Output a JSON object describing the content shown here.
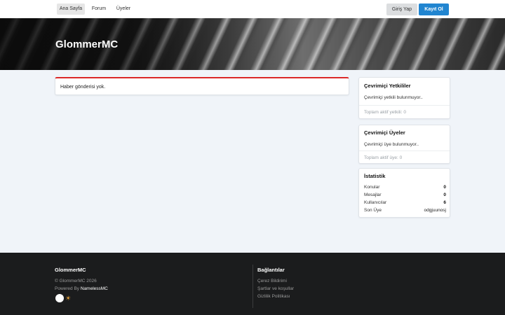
{
  "nav": {
    "items": [
      {
        "label": "Ana Sayfa",
        "active": true
      },
      {
        "label": "Forum",
        "active": false
      },
      {
        "label": "Üyeler",
        "active": false
      }
    ],
    "login_label": "Giriş Yap",
    "register_label": "Kayıt Ol"
  },
  "banner": {
    "title": "GlommerMC"
  },
  "news": {
    "empty_text": "Haber gönderisi yok."
  },
  "sidebar": {
    "staff": {
      "title": "Çevrimiçi Yetkililer",
      "empty_text": "Çevrimiçi yetkili bulunmuyor..",
      "total_text": "Toplam aktif yetkili: 0"
    },
    "members": {
      "title": "Çevrimiçi Üyeler",
      "empty_text": "Çevrimiçi üye bulunmuyor..",
      "total_text": "Toplam aktif üye: 0"
    },
    "stats": {
      "title": "İstatistik",
      "rows": [
        {
          "label": "Konular",
          "value": "0"
        },
        {
          "label": "Mesajlar",
          "value": "0"
        },
        {
          "label": "Kullanıcılar",
          "value": "6"
        },
        {
          "label": "Son Üye",
          "value": "odgjuunosj"
        }
      ]
    }
  },
  "footer": {
    "brand": "GlommerMC",
    "copyright": "© GlommerMC 2026",
    "powered_prefix": "Powered By ",
    "powered_name": "NamelessMC",
    "links_title": "Bağlantılar",
    "links": [
      "Çerez Bildirimi",
      "Şartlar ve koşullar",
      "Gizlilik Politikası"
    ]
  },
  "colors": {
    "accent": "#2185d0",
    "news_border": "#db2828",
    "footer_bg": "#1b1c1d",
    "theme_sun": "#f2a93b"
  },
  "icons": {
    "theme_toggle": "toggle-dot-icon",
    "theme_mode": "sun-icon"
  }
}
